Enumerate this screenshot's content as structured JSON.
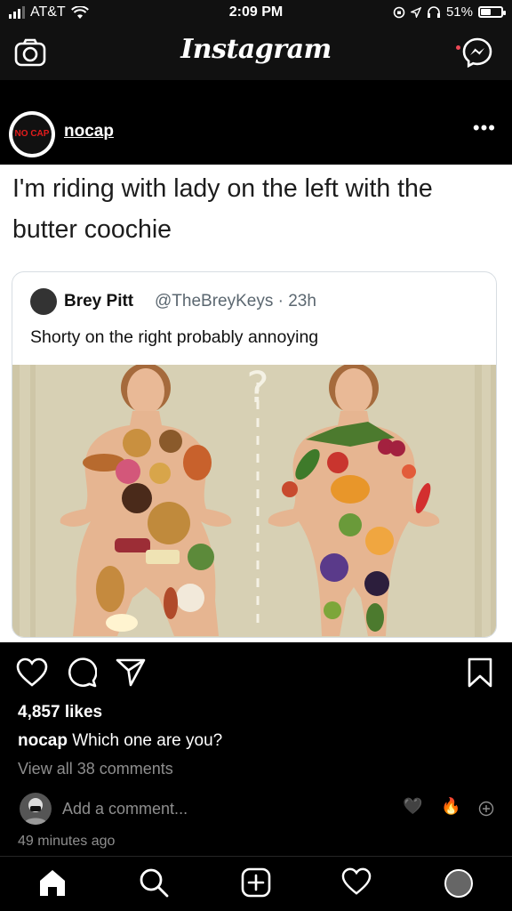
{
  "status_bar": {
    "carrier": "AT&T",
    "time": "2:09 PM",
    "battery_percent": "51%",
    "battery_level": 0.51
  },
  "header": {
    "logo": "Instagram",
    "icons": [
      "camera-icon",
      "messenger-icon"
    ]
  },
  "post": {
    "username": "nocap",
    "avatar_text": "NO CAP",
    "image": {
      "caption_text": "I'm riding with lady on the left with the butter coochie",
      "tweet": {
        "name": "Brey Pitt",
        "handle_time": "@TheBreyKeys · 23h",
        "text": "Shorty on the right probably annoying"
      }
    },
    "likes": "4,857 likes",
    "caption_user": "nocap",
    "caption_text": "Which one are you?",
    "view_comments": "View all 38 comments",
    "add_comment_placeholder": "Add a comment...",
    "quick_reactions": [
      "🖤",
      "🔥"
    ],
    "time_ago": "49 minutes ago"
  },
  "colors": {
    "accent_red": "#ed4956",
    "muted": "#8e8e8e",
    "twitter_gray": "#5b6770"
  },
  "tab_bar": {
    "icons": [
      "home-icon",
      "search-icon",
      "new-post-icon",
      "activity-heart-icon",
      "profile-avatar"
    ]
  }
}
